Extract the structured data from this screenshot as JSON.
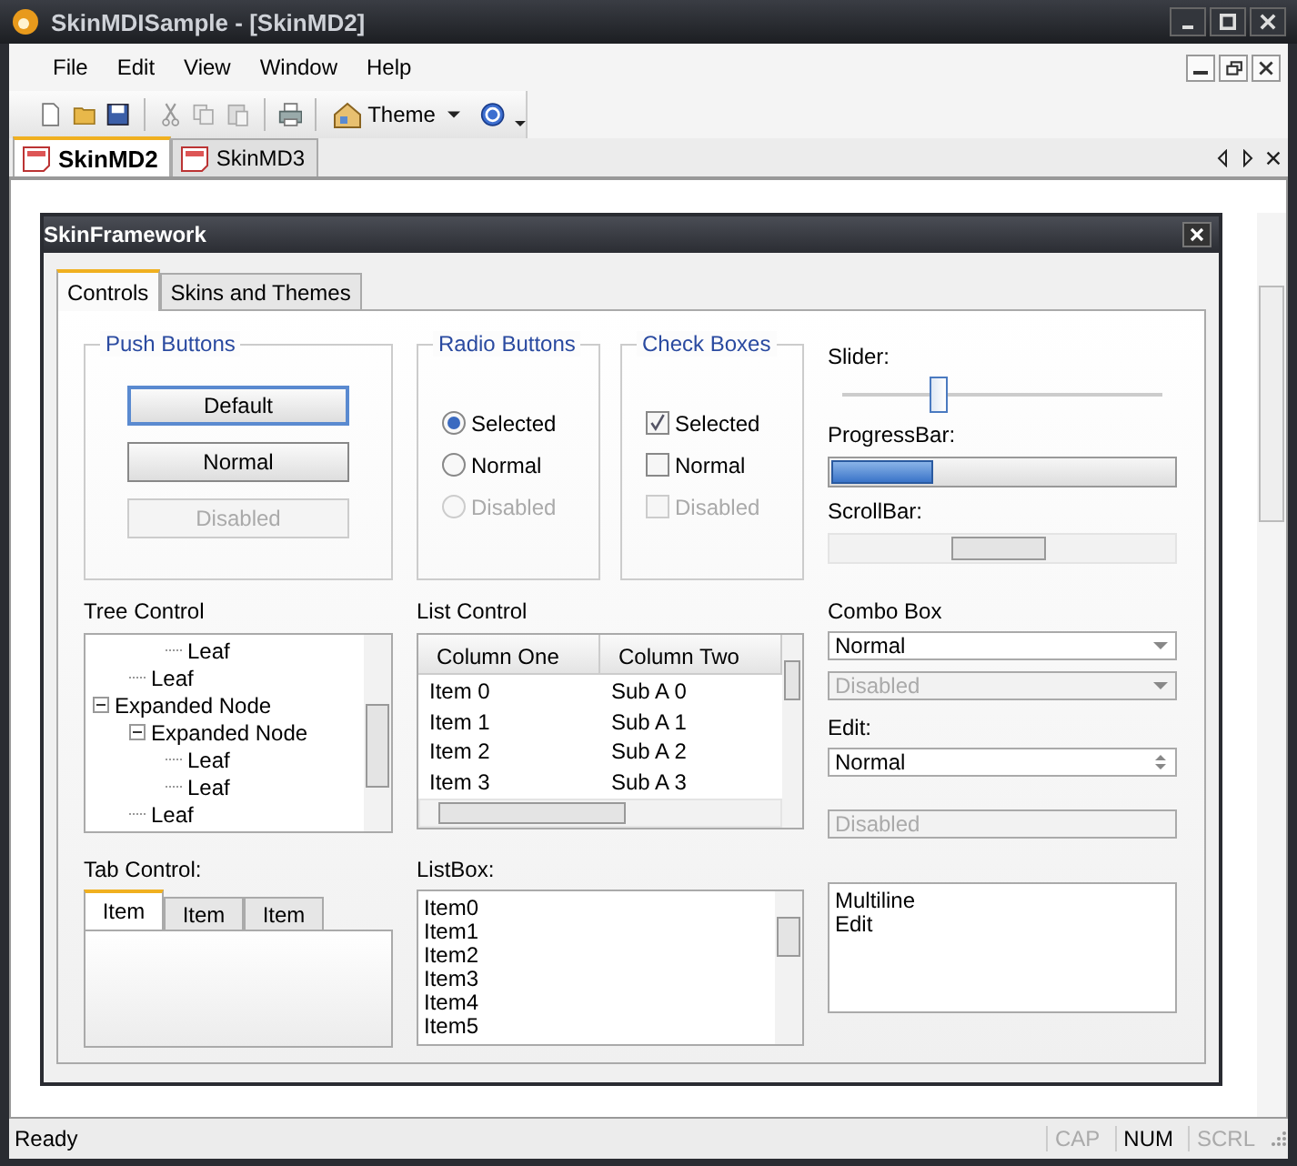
{
  "window": {
    "title": "SkinMDISample - [SkinMD2]"
  },
  "menu": [
    "File",
    "Edit",
    "View",
    "Window",
    "Help"
  ],
  "toolbar": {
    "theme_label": "Theme"
  },
  "doc_tabs": [
    {
      "label": "SkinMD2",
      "selected": true
    },
    {
      "label": "SkinMD3",
      "selected": false
    }
  ],
  "dialog": {
    "title": "SkinFramework",
    "tabs": [
      {
        "label": "Controls",
        "selected": true
      },
      {
        "label": "Skins and Themes",
        "selected": false
      }
    ],
    "push_buttons": {
      "title": "Push Buttons",
      "buttons": [
        {
          "label": "Default",
          "kind": "default"
        },
        {
          "label": "Normal",
          "kind": "normal"
        },
        {
          "label": "Disabled",
          "kind": "disabled"
        }
      ]
    },
    "radio_buttons": {
      "title": "Radio Buttons",
      "items": [
        {
          "label": "Selected",
          "selected": true,
          "disabled": false
        },
        {
          "label": "Normal",
          "selected": false,
          "disabled": false
        },
        {
          "label": "Disabled",
          "selected": false,
          "disabled": true
        }
      ]
    },
    "check_boxes": {
      "title": "Check Boxes",
      "items": [
        {
          "label": "Selected",
          "checked": true,
          "disabled": false
        },
        {
          "label": "Normal",
          "checked": false,
          "disabled": false
        },
        {
          "label": "Disabled",
          "checked": false,
          "disabled": true
        }
      ]
    },
    "slider": {
      "label": "Slider:",
      "level": 0.3
    },
    "progress": {
      "label": "ProgressBar:",
      "level": 0.3
    },
    "scrollbar": {
      "label": "ScrollBar:"
    },
    "tree": {
      "label": "Tree Control",
      "nodes": [
        {
          "children": [
            {
              "children": [
                {
                  "label": "Leaf"
                }
              ]
            },
            {
              "label": "Leaf"
            }
          ]
        },
        {
          "label": "Expanded Node",
          "expanded": true,
          "children": [
            {
              "label": "Expanded Node",
              "expanded": true,
              "children": [
                {
                  "label": "Leaf"
                },
                {
                  "label": "Leaf"
                }
              ]
            },
            {
              "label": "Leaf"
            }
          ]
        }
      ]
    },
    "list_control": {
      "label": "List Control",
      "columns": [
        "Column One",
        "Column Two"
      ],
      "rows": [
        [
          "Item 0",
          "Sub A 0"
        ],
        [
          "Item 1",
          "Sub A 1"
        ],
        [
          "Item 2",
          "Sub A 2"
        ],
        [
          "Item 3",
          "Sub A 3"
        ]
      ]
    },
    "tab_control": {
      "label": "Tab Control:",
      "tabs": [
        {
          "label": "Item",
          "selected": true
        },
        {
          "label": "Item",
          "selected": false
        },
        {
          "label": "Item",
          "selected": false
        }
      ]
    },
    "listbox": {
      "label": "ListBox:",
      "items": [
        "Item0",
        "Item1",
        "Item2",
        "Item3",
        "Item4",
        "Item5"
      ]
    },
    "combo": {
      "label": "Combo Box",
      "fields": [
        {
          "value": "Normal",
          "disabled": false
        },
        {
          "value": "Disabled",
          "disabled": true
        }
      ]
    },
    "edit": {
      "label": "Edit:",
      "spin_value": "Normal",
      "disabled_value": "Disabled",
      "multiline": [
        "Multiline",
        "Edit"
      ]
    }
  },
  "status_bar": {
    "text": "Ready",
    "indicators": [
      {
        "label": "CAP",
        "on": false
      },
      {
        "label": "NUM",
        "on": true
      },
      {
        "label": "SCRL",
        "on": false
      }
    ]
  }
}
